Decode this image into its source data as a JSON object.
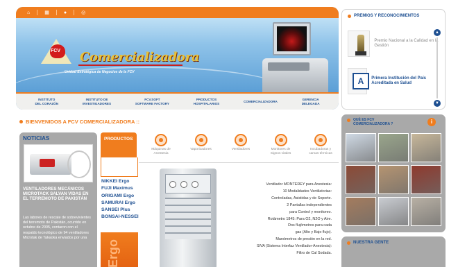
{
  "header": {
    "brand": "Comercializadora",
    "logo_text": "FCV",
    "tagline": "Unidad Estratégica de Negocios de la FCV",
    "top_icons": [
      "home-icon",
      "building-icon",
      "people-icon",
      "globe-icon"
    ],
    "nav": [
      {
        "line1": "INSTITUTO",
        "line2": "DEL CORAZÓN"
      },
      {
        "line1": "INSTITUTO DE",
        "line2": "INVESTIGADORES"
      },
      {
        "line1": "FCV.SOFT",
        "line2": "SOFTWARE FACTORY"
      },
      {
        "line1": "PRODUCTOS",
        "line2": "HOSPITALARIOS"
      },
      {
        "line1": "COMERCIALIZADORA",
        "line2": ""
      },
      {
        "line1": "GERENCIA",
        "line2": "DELEGADA"
      }
    ]
  },
  "awards": {
    "title": "PREMIOS Y RECONOCIMIENTOS",
    "items": [
      {
        "text": "Premio Nacional a la Calidad en la Gestión"
      },
      {
        "text": "Primera Institución del País Acreditada en Salud"
      }
    ]
  },
  "que_es": {
    "title_line1": "QUÉ ES FCV",
    "title_line2": "COMERCIALIZADORA ?",
    "info": "i"
  },
  "nuestra_gente": {
    "title": "NUESTRA GENTE"
  },
  "welcome": "BIENVENIDOS A FCV COMERCIALIZADORA ::",
  "news": {
    "title": "NOTICIAS",
    "headline": "VENTILADORES MECÁNICOS MICROTACK SALVAN VIDAS EN EL TERREMOTO DE PAKISTÁN",
    "body": "Las labores de rescate de sobrevivientes del terremoto de Pakistán, ocurrido en octubre de 2005, contaron con el respaldo tecnológico de 94 ventiladores Microtak de Takaoka enviados por una"
  },
  "products": {
    "tab": "PRODUCTOS",
    "list": [
      "NIKKEI Ergo",
      "FUJI Maximus",
      "ORIGAMI Ergo",
      "SAMURAI Ergo",
      "SANSEI Plus",
      "BONSAI-NESSEI"
    ],
    "feature_word": "Ergo",
    "categories": [
      {
        "line1": "Máquinas de",
        "line2": "Anestesia"
      },
      {
        "line1": "Vaporizadores",
        "line2": ""
      },
      {
        "line1": "Ventiladores",
        "line2": ""
      },
      {
        "line1": "Monitores de",
        "line2": "Signos vitales"
      },
      {
        "line1": "Incubadoras y",
        "line2": "camas térmicas"
      }
    ],
    "description": [
      "Ventilador MONTEREY para Anestesia:",
      "10 Modalidades Ventilatorias:",
      "Controladas, Asistidas y de Soporte.",
      "2 Pantallas independientes",
      "para Control y monitoreo.",
      "Rotámetro 1845: Para O2, N2O y Aire.",
      "Dos flujómetros para cada",
      "gas (Alto y Bajo flujo).",
      "Manómetros de presión en la red.",
      "SIVA (Sistema Interfaz Ventilador-Anestesia):",
      "Filtro de Cal Sodada."
    ]
  },
  "colors": {
    "accent": "#f07d1e",
    "navy": "#1d4f91",
    "panel_gray": "#a9a9a9",
    "thumbs": [
      "#cfd9e4",
      "#9aa68c",
      "#c7b79a",
      "#8c4a36",
      "#b59471",
      "#8f3a2e",
      "#a47c5e",
      "#c9ccd1",
      "#b8b0a4"
    ]
  }
}
